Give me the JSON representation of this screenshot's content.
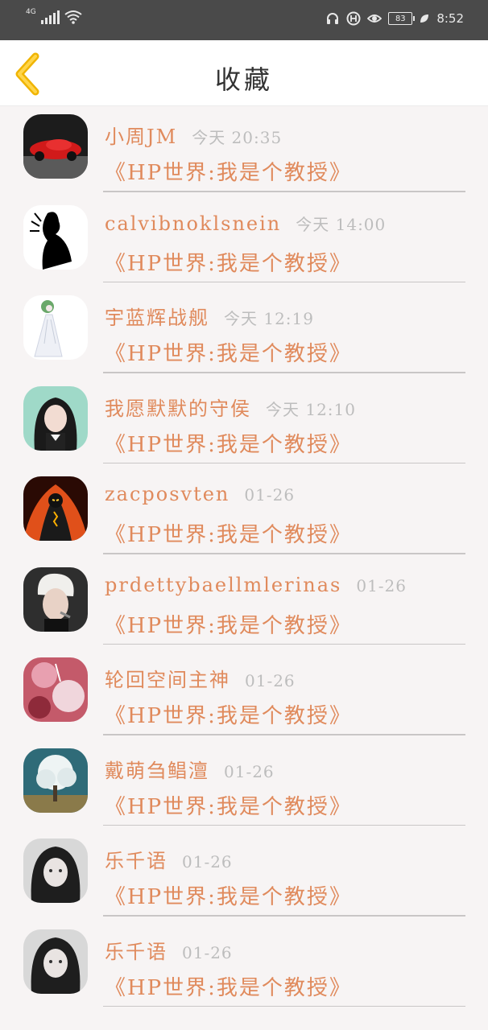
{
  "status_bar": {
    "network": "4G",
    "battery": "83",
    "time": "8:52"
  },
  "header": {
    "title": "收藏"
  },
  "favorites": [
    {
      "user": "小周JM",
      "time": "今天 20:35",
      "title": "《HP世界:我是个教授》",
      "avatar": "red-car-avatar"
    },
    {
      "user": "calvibnoklsnein",
      "time": "今天 14:00",
      "title": "《HP世界:我是个教授》",
      "avatar": "silhouette-avatar"
    },
    {
      "user": "宇蓝辉战舰",
      "time": "今天 12:19",
      "title": "《HP世界:我是个教授》",
      "avatar": "gardevoir-avatar"
    },
    {
      "user": "我愿默默的守侯",
      "time": "今天 12:10",
      "title": "《HP世界:我是个教授》",
      "avatar": "girl-avatar"
    },
    {
      "user": "zacposvten",
      "time": "01-26",
      "title": "《HP世界:我是个教授》",
      "avatar": "fire-figure-avatar"
    },
    {
      "user": "prdettybaellmlerinas",
      "time": "01-26",
      "title": "《HP世界:我是个教授》",
      "avatar": "white-hair-man-avatar"
    },
    {
      "user": "轮回空间主神",
      "time": "01-26",
      "title": "《HP世界:我是个教授》",
      "avatar": "pink-art-avatar"
    },
    {
      "user": "戴萌刍鲳澶",
      "time": "01-26",
      "title": "《HP世界:我是个教授》",
      "avatar": "white-tree-avatar"
    },
    {
      "user": "乐千语",
      "time": "01-26",
      "title": "《HP世界:我是个教授》",
      "avatar": "dark-hair-girl-avatar"
    },
    {
      "user": "乐千语",
      "time": "01-26",
      "title": "《HP世界:我是个教授》",
      "avatar": "dark-hair-girl-avatar"
    }
  ],
  "colors": {
    "accent": "#e08a5c",
    "back_arrow": "#f0b400",
    "status_bar": "#4a4a4a"
  }
}
